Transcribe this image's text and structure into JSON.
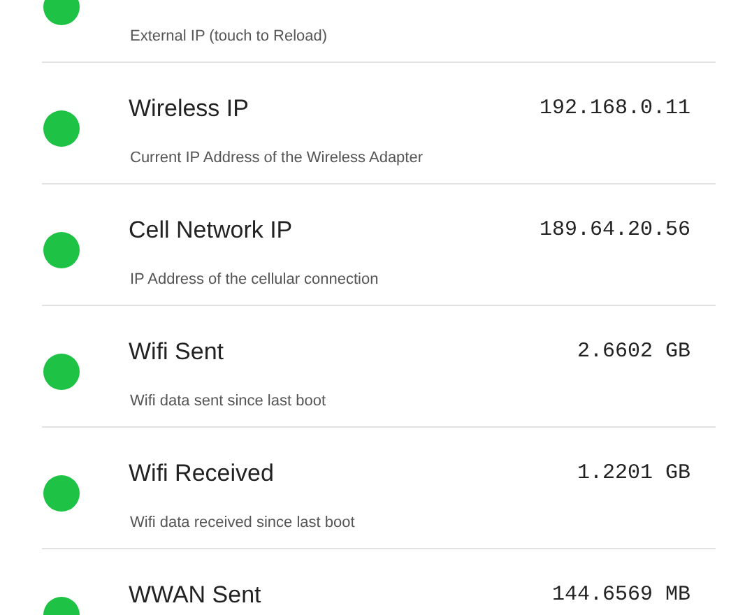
{
  "rows": [
    {
      "subtitle": "External IP (touch to Reload)"
    },
    {
      "title": "Wireless IP",
      "value": "192.168.0.11",
      "subtitle": "Current IP Address of the Wireless Adapter"
    },
    {
      "title": "Cell Network IP",
      "value": "189.64.20.56",
      "subtitle": "IP Address of the cellular connection"
    },
    {
      "title": "Wifi Sent",
      "value": "2.6602 GB",
      "subtitle": "Wifi data sent since last boot"
    },
    {
      "title": "Wifi Received",
      "value": "1.2201 GB",
      "subtitle": "Wifi data received since last boot"
    },
    {
      "title": "WWAN Sent",
      "value": "144.6569 MB"
    }
  ]
}
